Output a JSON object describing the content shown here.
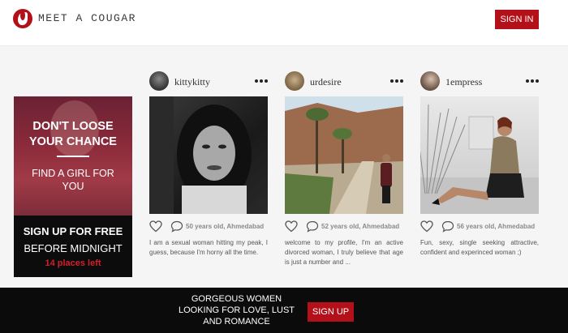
{
  "header": {
    "logo_text": "MEET A COUGAR",
    "signin_label": "SIGN IN"
  },
  "promo": {
    "headline_line1": "DON'T LOOSE",
    "headline_line2": "YOUR CHANCE",
    "sub_line1": "FIND A GIRL FOR",
    "sub_line2": "YOU",
    "cta_line1": "SIGN UP FOR FREE",
    "cta_line2": "BEFORE MIDNIGHT",
    "cta_line3": "14 places left"
  },
  "profiles": [
    {
      "username": "kittykitty",
      "meta": "50 years old, Ahmedabad",
      "description": "I am a sexual woman hitting my peak, I guess, because I'm horny all the time."
    },
    {
      "username": "urdesire",
      "meta": "52 years old, Ahmedabad",
      "description": "welcome to my profile, I'm an active divorced woman, I truly believe that age is just a number and ..."
    },
    {
      "username": "1empress",
      "meta": "56 years old, Ahmedabad",
      "description": "Fun, sexy, single seeking attractive, confident and experinced woman ;)"
    }
  ],
  "footer": {
    "text_line1": "GORGEOUS WOMEN",
    "text_line2": "LOOKING FOR LOVE, LUST",
    "text_line3": "AND ROMANCE",
    "signup_label": "SIGN UP"
  },
  "colors": {
    "brand_red": "#b3101a",
    "footer_bg": "#0b0b0b"
  },
  "icons": [
    "logo-icon",
    "more-options-icon",
    "heart-icon",
    "comment-icon"
  ]
}
